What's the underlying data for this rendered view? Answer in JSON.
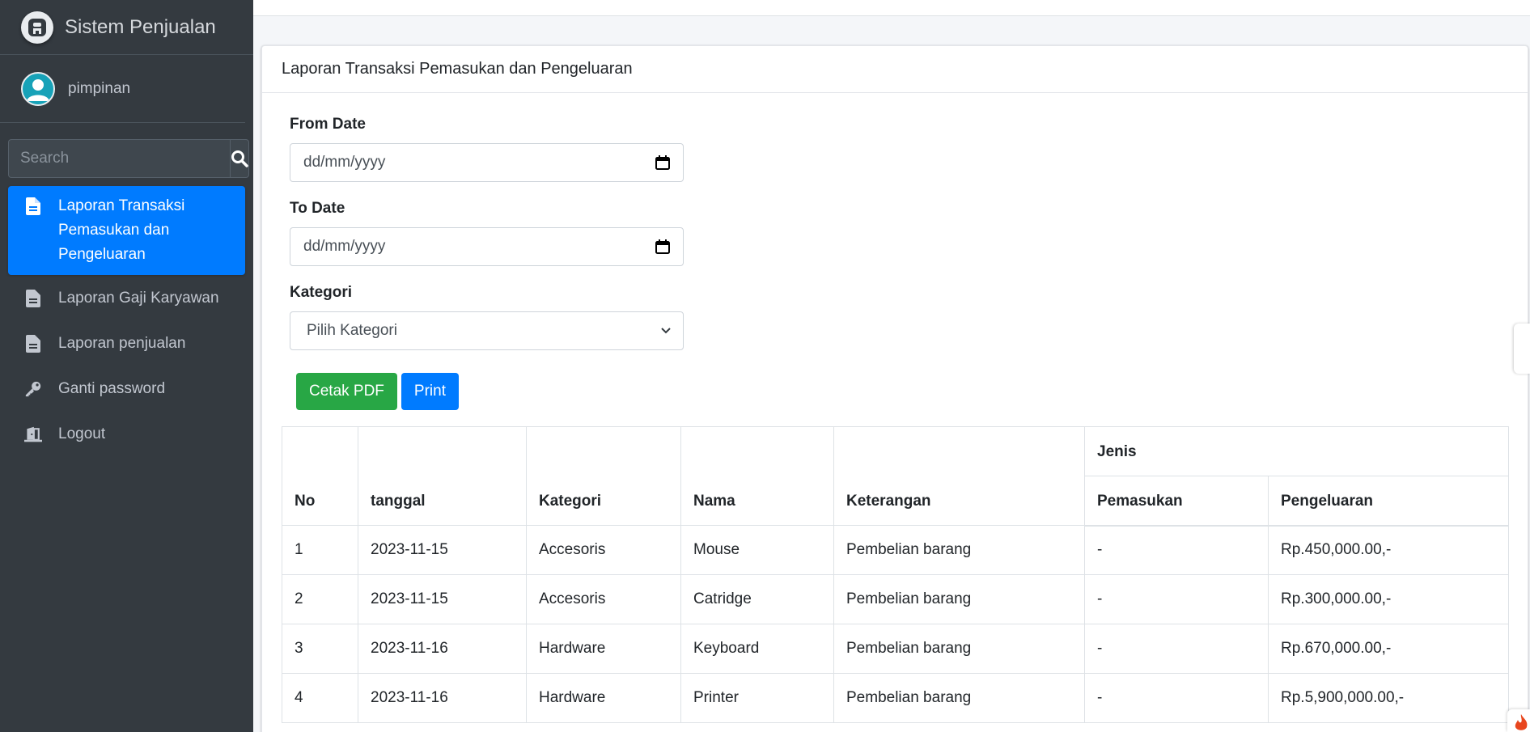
{
  "app": {
    "brand": "Sistem Penjualan",
    "user": "pimpinan"
  },
  "sidebar": {
    "search_placeholder": "Search",
    "items": [
      {
        "label": "Laporan Transaksi Pemasukan dan Pengeluaran",
        "icon": "file-icon",
        "active": true
      },
      {
        "label": "Laporan Gaji Karyawan",
        "icon": "file-icon",
        "active": false
      },
      {
        "label": "Laporan penjualan",
        "icon": "file-icon",
        "active": false
      },
      {
        "label": "Ganti password",
        "icon": "key-icon",
        "active": false
      },
      {
        "label": "Logout",
        "icon": "door-icon",
        "active": false
      }
    ]
  },
  "main": {
    "title": "Laporan Transaksi Pemasukan dan Pengeluaran",
    "from_date_label": "From Date",
    "from_date_value": "dd/mm/yyyy",
    "to_date_label": "To Date",
    "to_date_value": "dd/mm/yyyy",
    "kategori_label": "Kategori",
    "kategori_selected": "Pilih Kategori",
    "btn_pdf": "Cetak PDF",
    "btn_print": "Print"
  },
  "table": {
    "headers": {
      "no": "No",
      "tanggal": "tanggal",
      "kategori": "Kategori",
      "nama": "Nama",
      "keterangan": "Keterangan",
      "jenis": "Jenis",
      "pemasukan": "Pemasukan",
      "pengeluaran": "Pengeluaran"
    },
    "rows": [
      {
        "no": "1",
        "tanggal": "2023-11-15",
        "kategori": "Accesoris",
        "nama": "Mouse",
        "keterangan": "Pembelian barang",
        "pemasukan": "-",
        "pengeluaran": "Rp.450,000.00,-"
      },
      {
        "no": "2",
        "tanggal": "2023-11-15",
        "kategori": "Accesoris",
        "nama": "Catridge",
        "keterangan": "Pembelian barang",
        "pemasukan": "-",
        "pengeluaran": "Rp.300,000.00,-"
      },
      {
        "no": "3",
        "tanggal": "2023-11-16",
        "kategori": "Hardware",
        "nama": "Keyboard",
        "keterangan": "Pembelian barang",
        "pemasukan": "-",
        "pengeluaran": "Rp.670,000.00,-"
      },
      {
        "no": "4",
        "tanggal": "2023-11-16",
        "kategori": "Hardware",
        "nama": "Printer",
        "keterangan": "Pembelian barang",
        "pemasukan": "-",
        "pengeluaran": "Rp.5,900,000.00,-"
      }
    ]
  },
  "colors": {
    "sidebar_bg": "#343a40",
    "active": "#007bff",
    "success": "#28a745"
  }
}
